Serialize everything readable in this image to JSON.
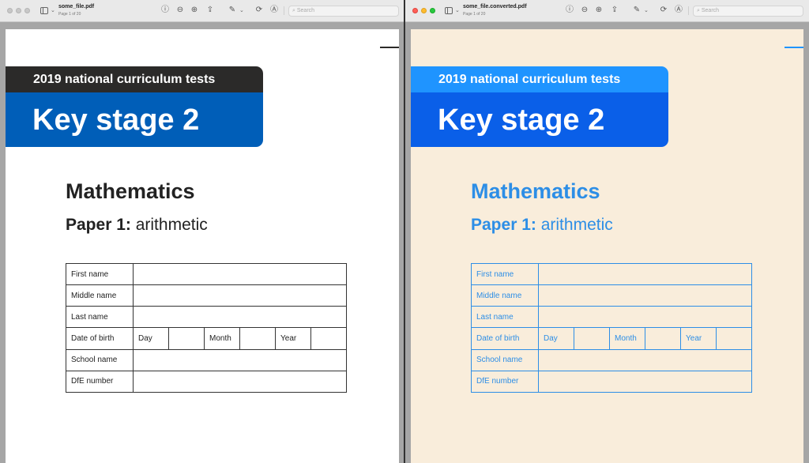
{
  "windows": [
    {
      "file_name": "some_file.pdf",
      "page_info": "Page 1 of 20",
      "search_placeholder": "Search",
      "toolbar_icons": [
        "sidebar-icon",
        "info-icon",
        "zoom-out-icon",
        "zoom-in-icon",
        "share-icon",
        "markup-icon",
        "rotate-icon",
        "annotate-icon",
        "search-icon"
      ]
    },
    {
      "file_name": "some_file.converted.pdf",
      "page_info": "Page 1 of 20",
      "search_placeholder": "Search",
      "toolbar_icons": [
        "sidebar-icon",
        "info-icon",
        "zoom-out-icon",
        "zoom-in-icon",
        "share-icon",
        "markup-icon",
        "rotate-icon",
        "annotate-icon",
        "search-icon"
      ]
    }
  ],
  "document": {
    "test_title": "2019 national curriculum tests",
    "key_stage": "Key stage 2",
    "subject": "Mathematics",
    "paper_label": "Paper 1:",
    "paper_name": "arithmetic",
    "form": {
      "first_name": "First name",
      "middle_name": "Middle name",
      "last_name": "Last name",
      "date_of_birth": "Date of birth",
      "day": "Day",
      "month": "Month",
      "year": "Year",
      "school_name": "School name",
      "dfe_number": "DfE number"
    }
  },
  "colors": {
    "original_top_band": "#2b2a29",
    "original_key_stage_band": "#005eb8",
    "original_text": "#222222",
    "converted_top_band": "#1f94ff",
    "converted_key_stage_band": "#0a5fe8",
    "converted_text": "#2d8ee6",
    "converted_background": "#f9eddb"
  }
}
